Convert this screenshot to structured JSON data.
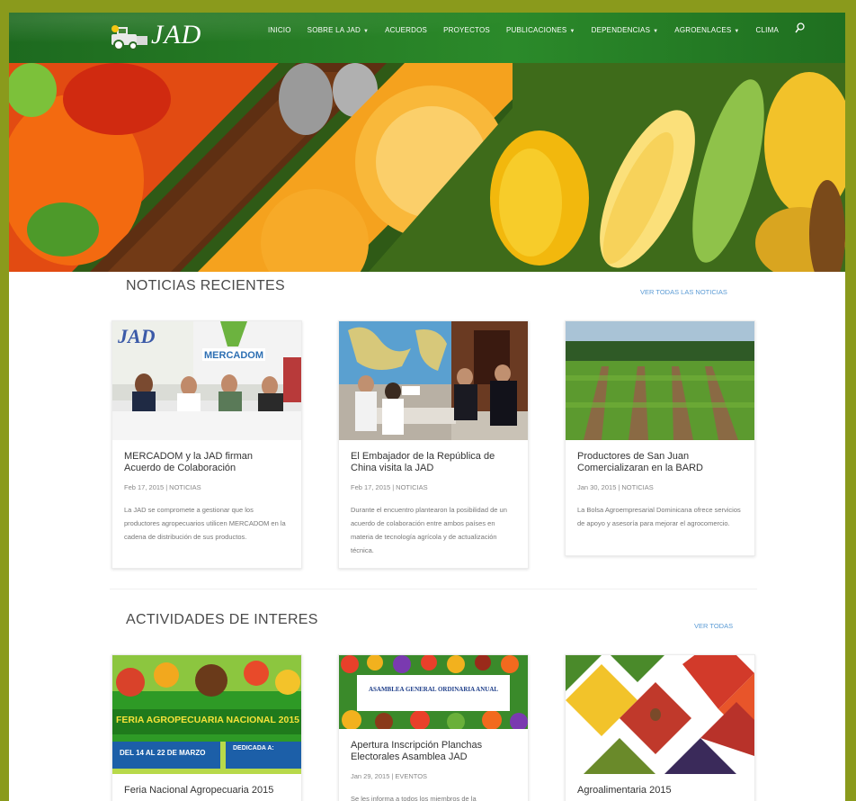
{
  "logo": {
    "text": "JAD"
  },
  "nav": {
    "items": [
      {
        "label": "INICIO",
        "dropdown": false
      },
      {
        "label": "SOBRE LA JAD",
        "dropdown": true
      },
      {
        "label": "ACUERDOS",
        "dropdown": false
      },
      {
        "label": "PROYECTOS",
        "dropdown": false
      },
      {
        "label": "PUBLICACIONES",
        "dropdown": true
      },
      {
        "label": "DEPENDENCIAS",
        "dropdown": true
      },
      {
        "label": "AGROENLACES",
        "dropdown": true
      },
      {
        "label": "CLIMA",
        "dropdown": false
      }
    ],
    "search_icon": "search-icon"
  },
  "hero": {
    "slides_total": 3,
    "active_slide": 1
  },
  "news": {
    "title": "NOTICIAS RECIENTES",
    "link": "VER TODAS LAS NOTICIAS",
    "cards": [
      {
        "title": "MERCADOM y la JAD firman Acuerdo de Colaboración",
        "date": "Feb 17, 2015",
        "category": "NOTICIAS",
        "excerpt": "La JAD se compromete a gestionar que los productores agropecuarios utilicen MERCADOM en la cadena de distribución de sus productos."
      },
      {
        "title": "El Embajador de la República de China visita la JAD",
        "date": "Feb 17, 2015",
        "category": "NOTICIAS",
        "excerpt": "Durante el encuentro plantearon la posibilidad de un acuerdo de colaboración entre ambos países en materia de tecnología agrícola y de actualización técnica."
      },
      {
        "title": "Productores de San Juan Comercializaran en la BARD",
        "date": "Jan 30, 2015",
        "category": "NOTICIAS",
        "excerpt": "La Bolsa Agroempresarial Dominicana ofrece servicios de apoyo y asesoría para mejorar el agrocomercio."
      }
    ]
  },
  "activities": {
    "title": "ACTIVIDADES DE INTERES",
    "link": "VER TODAS",
    "cards": [
      {
        "title": "Feria Nacional Agropecuaria 2015",
        "date": "",
        "category": "",
        "excerpt": "",
        "image_text": {
          "headline": "FERIA AGROPECUARIA NACIONAL 2015",
          "dates": "DEL 14 AL 22 DE MARZO",
          "dedication": "DEDICADA A:"
        }
      },
      {
        "title": "Apertura Inscripción Planchas Electorales Asamblea JAD",
        "date": "Jan 29, 2015",
        "category": "EVENTOS",
        "excerpt": "Se les informa a todos los miembros de la",
        "image_text": {
          "headline": "ASAMBLEA GENERAL ORDINARIA ANUAL"
        }
      },
      {
        "title": "Agroalimentaria 2015",
        "date": "",
        "category": "",
        "excerpt": ""
      }
    ]
  },
  "colors": {
    "header_green": "#257a24",
    "link_blue": "#5b9bd5",
    "page_border": "#8a9a1c"
  }
}
